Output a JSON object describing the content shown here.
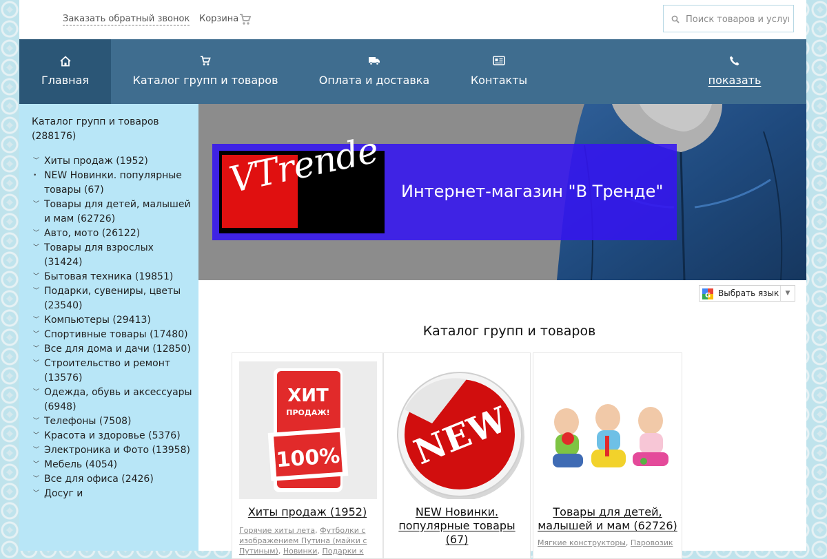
{
  "topbar": {
    "callback_label": "Заказать обратный звонок",
    "cart_label": "Корзина",
    "search_placeholder": "Поиск товаров и услуг"
  },
  "nav": [
    {
      "label": "Главная",
      "icon": "home-icon",
      "active": true
    },
    {
      "label": "Каталог групп и товаров",
      "icon": "cart-icon"
    },
    {
      "label": "Оплата и доставка",
      "icon": "truck-icon"
    },
    {
      "label": "Контакты",
      "icon": "contact-card-icon"
    },
    {
      "label": "показать",
      "icon": "phone-icon"
    }
  ],
  "sidebar": {
    "title": "Каталог групп и товаров (288176)",
    "items": [
      {
        "label": "Хиты продаж (1952)",
        "marker": "chevron"
      },
      {
        "label": "NEW Новинки. популярные товары (67)",
        "marker": "dot"
      },
      {
        "label": "Товары для детей, малышей и мам (62726)",
        "marker": "chevron"
      },
      {
        "label": "Авто, мото (26122)",
        "marker": "chevron"
      },
      {
        "label": "Товары для взрослых (31424)",
        "marker": "chevron"
      },
      {
        "label": "Бытовая техника (19851)",
        "marker": "chevron"
      },
      {
        "label": "Подарки, сувениры, цветы (23540)",
        "marker": "chevron"
      },
      {
        "label": "Компьютеры (29413)",
        "marker": "chevron"
      },
      {
        "label": "Спортивные товары (17480)",
        "marker": "chevron"
      },
      {
        "label": "Все для дома и дачи (12850)",
        "marker": "chevron"
      },
      {
        "label": "Строительство и ремонт (13576)",
        "marker": "chevron"
      },
      {
        "label": "Одежда, обувь и аксессуары (6948)",
        "marker": "chevron"
      },
      {
        "label": "Телефоны (7508)",
        "marker": "chevron"
      },
      {
        "label": "Красота и здоровье (5376)",
        "marker": "chevron"
      },
      {
        "label": "Электроника и Фото (13958)",
        "marker": "chevron"
      },
      {
        "label": "Мебель (4054)",
        "marker": "chevron"
      },
      {
        "label": "Все для офиса (2426)",
        "marker": "chevron"
      },
      {
        "label": "Досуг и",
        "marker": "chevron"
      }
    ]
  },
  "banner": {
    "logo_text": "VTrende",
    "title": "Интернет-магазин \"В Тренде\"",
    "panel_color": "#3414f0"
  },
  "translate": {
    "label": "Выбрать язык"
  },
  "catalog": {
    "heading": "Каталог групп и товаров",
    "cards": [
      {
        "title": "Хиты продаж (1952)",
        "image_text_top": "ХИТ",
        "image_text_sub": "ПРОДАЖ!",
        "image_text_pct": "100%",
        "tags_text": [
          {
            "text": "Горячие хиты лета",
            "link": true
          },
          {
            "text": ", ",
            "link": false
          },
          {
            "text": "Футболки с изображением Путина (майки с Путиным)",
            "link": true
          },
          {
            "text": ", ",
            "link": false
          },
          {
            "text": "Новинки",
            "link": true
          },
          {
            "text": ", ",
            "link": false
          },
          {
            "text": "Подарки к",
            "link": true
          }
        ]
      },
      {
        "title": "NEW Новинки. популярные товары (67)",
        "image_text": "NEW"
      },
      {
        "title": "Товары для детей, малышей и мам (62726)",
        "tags_text": [
          {
            "text": "Мягкие конструкторы",
            "link": true
          },
          {
            "text": ", ",
            "link": false
          },
          {
            "text": "Паровозик",
            "link": true
          }
        ]
      }
    ]
  },
  "colors": {
    "nav_bg": "#3f6d8f",
    "nav_active_bg": "#2b5676",
    "sidebar_bg": "#b8e6f7"
  }
}
